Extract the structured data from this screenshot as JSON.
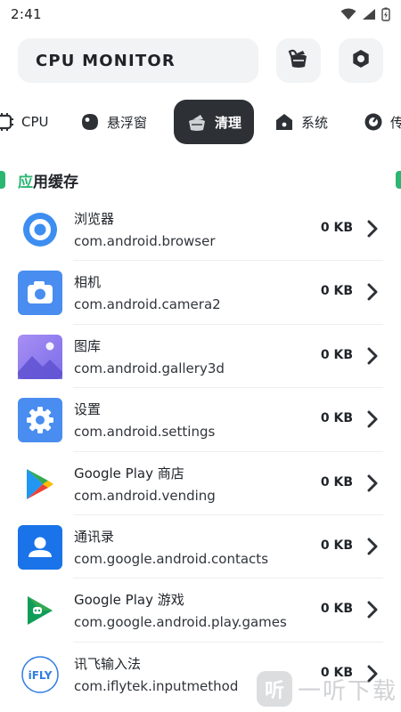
{
  "status_bar": {
    "time": "2:41",
    "icons": [
      "wifi-icon",
      "signal-icon",
      "battery-charging-icon"
    ]
  },
  "header": {
    "title": "CPU MONITOR",
    "clean_button_icon": "broom-icon",
    "settings_button_icon": "hexagon-settings-icon"
  },
  "tabs": [
    {
      "label": "CPU",
      "icon": "chip-icon",
      "active": false
    },
    {
      "label": "悬浮窗",
      "icon": "floating-window-icon",
      "active": false
    },
    {
      "label": "清理",
      "icon": "broom-icon",
      "active": true
    },
    {
      "label": "系统",
      "icon": "home-icon",
      "active": false
    },
    {
      "label": "传",
      "icon": "sensor-icon",
      "active": false
    }
  ],
  "section": {
    "title_accent": "应",
    "title_rest": "用缓存"
  },
  "apps": [
    {
      "name": "浏览器",
      "package": "com.android.browser",
      "size": "0 KB",
      "icon": "browser-icon"
    },
    {
      "name": "相机",
      "package": "com.android.camera2",
      "size": "0 KB",
      "icon": "camera-icon"
    },
    {
      "name": "图库",
      "package": "com.android.gallery3d",
      "size": "0 KB",
      "icon": "gallery-icon"
    },
    {
      "name": "设置",
      "package": "com.android.settings",
      "size": "0 KB",
      "icon": "settings-gear-icon"
    },
    {
      "name": "Google Play 商店",
      "package": "com.android.vending",
      "size": "0 KB",
      "icon": "play-store-icon"
    },
    {
      "name": "通讯录",
      "package": "com.google.android.contacts",
      "size": "0 KB",
      "icon": "contacts-icon"
    },
    {
      "name": "Google Play 游戏",
      "package": "com.google.android.play.games",
      "size": "0 KB",
      "icon": "play-games-icon"
    },
    {
      "name": "讯飞输入法",
      "package": "com.iflytek.inputmethod",
      "size": "0 KB",
      "icon": "ifly-icon"
    }
  ],
  "watermark": {
    "logo_glyph": "听",
    "text": "一听下载"
  },
  "colors": {
    "accent": "#2bb673",
    "active_tab": "#2d3136",
    "pill_bg": "#f1f3f4"
  }
}
